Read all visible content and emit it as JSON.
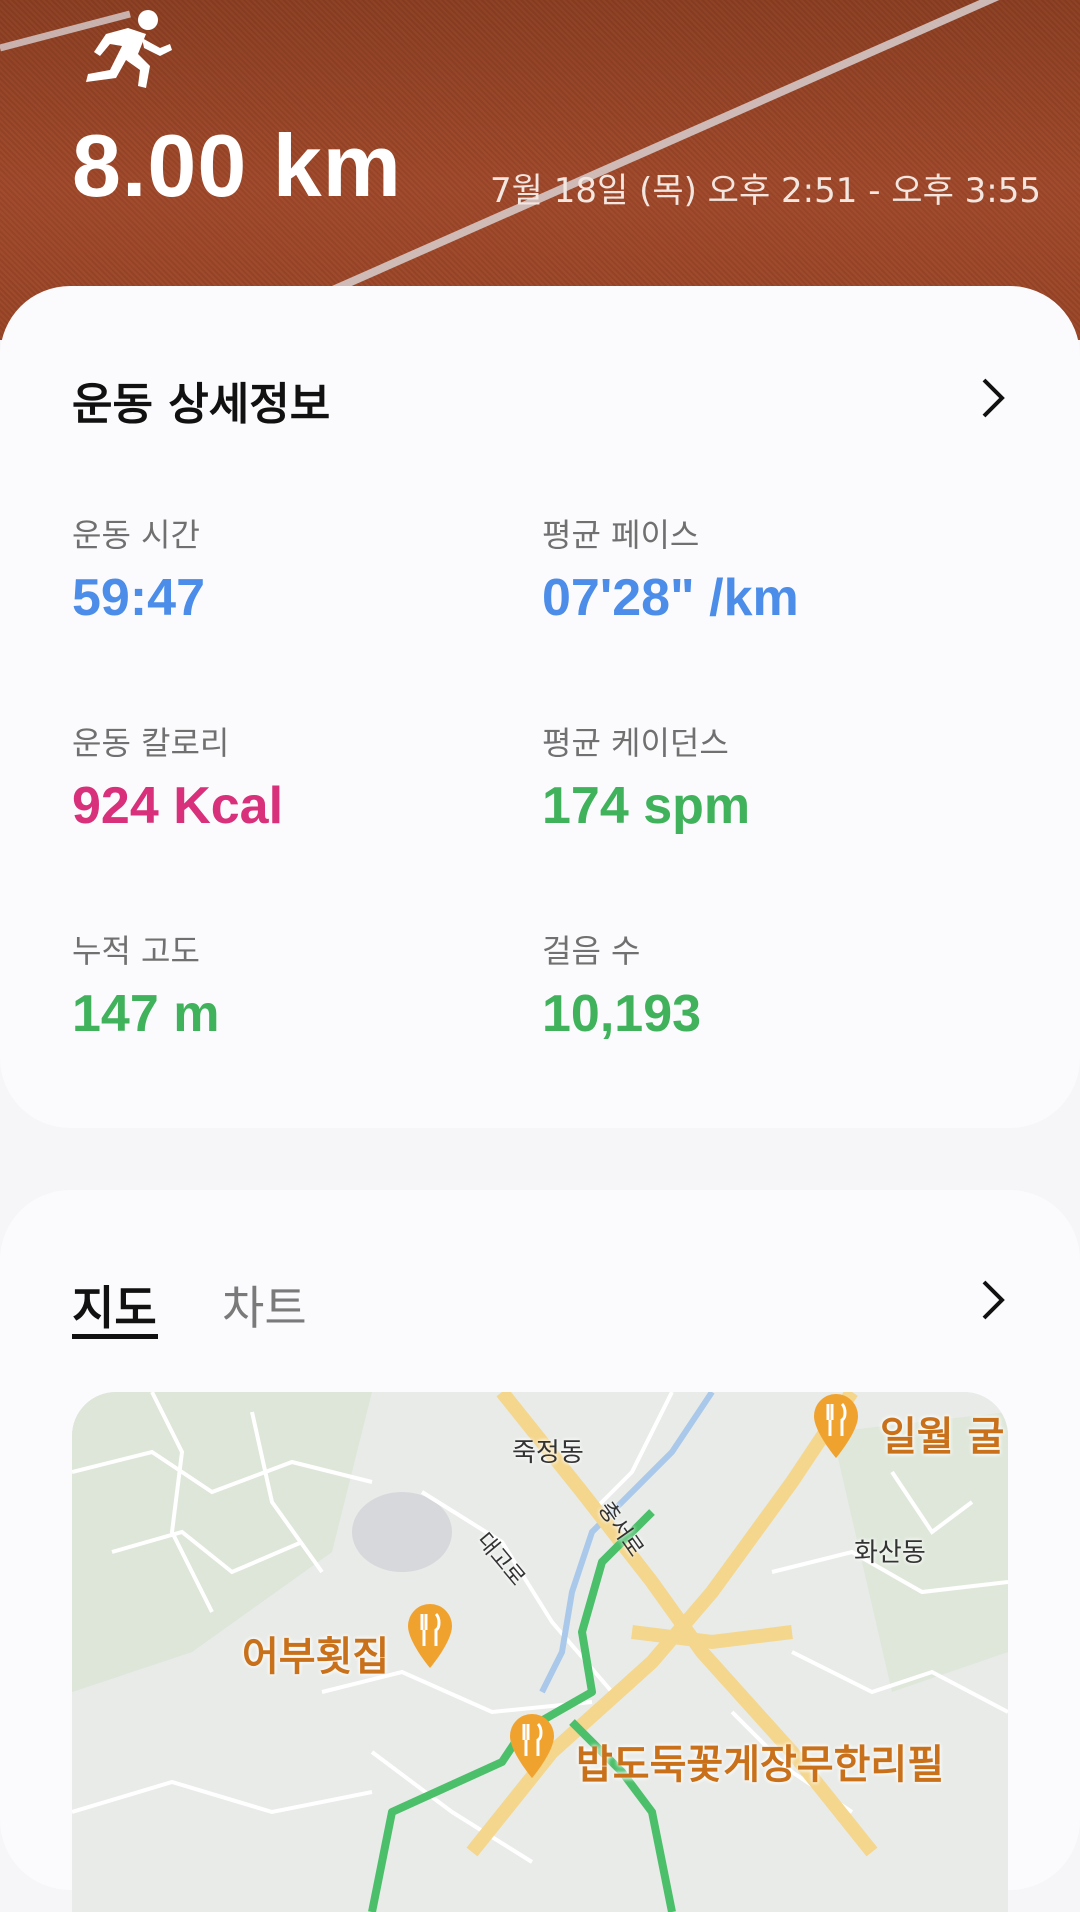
{
  "header": {
    "distance": "8.00 km",
    "datetime": "7월 18일 (목) 오후 2:51 - 오후 3:55",
    "activity_icon": "running-icon"
  },
  "details": {
    "title": "운동 상세정보",
    "stats": [
      {
        "label": "운동 시간",
        "value": "59:47",
        "color": "#4b8de8"
      },
      {
        "label": "평균 페이스",
        "value": "07'28\" /km",
        "color": "#4b8de8"
      },
      {
        "label": "운동 칼로리",
        "value": "924 Kcal",
        "color": "#d8307a"
      },
      {
        "label": "평균 케이던스",
        "value": "174 spm",
        "color": "#3fb25b"
      },
      {
        "label": "누적 고도",
        "value": "147 m",
        "color": "#3fb25b"
      },
      {
        "label": "걸음 수",
        "value": "10,193",
        "color": "#3fb25b"
      }
    ]
  },
  "map_card": {
    "tabs": [
      "지도",
      "차트"
    ],
    "active_tab": "지도",
    "map": {
      "place_labels": [
        "죽정동",
        "화산동",
        "대고로",
        "충서로"
      ],
      "poi_labels": [
        "일월 굴",
        "어부횟집",
        "밥도둑꽃게장무한리필"
      ],
      "poi_icon": "restaurant-pin-icon",
      "route_color": "#4cbf6a"
    }
  }
}
